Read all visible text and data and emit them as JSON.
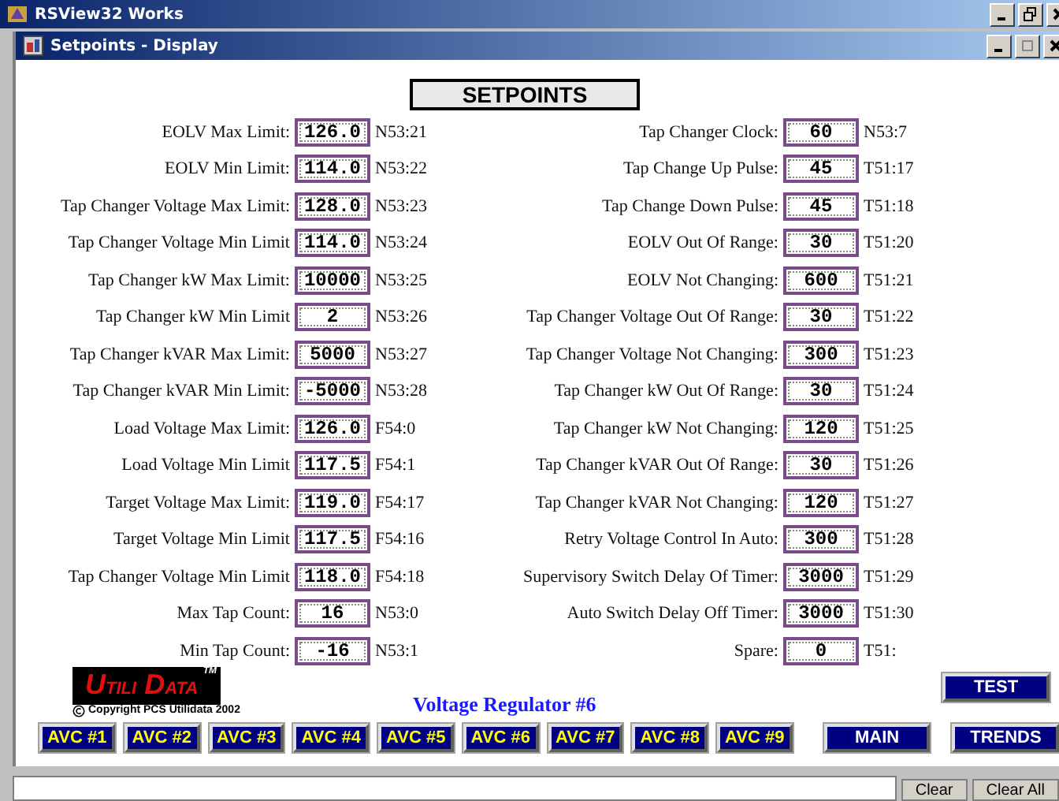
{
  "app_title": "RSView32 Works",
  "window": {
    "title": "Setpoints - Display"
  },
  "heading": "SETPOINTS",
  "left": [
    {
      "label": "EOLV Max Limit:",
      "value": "126.0",
      "address": "N53:21"
    },
    {
      "label": "EOLV Min Limit:",
      "value": "114.0",
      "address": "N53:22"
    },
    {
      "label": "Tap Changer Voltage Max Limit:",
      "value": "128.0",
      "address": "N53:23"
    },
    {
      "label": "Tap Changer Voltage Min Limit",
      "value": "114.0",
      "address": "N53:24"
    },
    {
      "label": "Tap Changer kW Max Limit:",
      "value": "10000",
      "address": "N53:25"
    },
    {
      "label": "Tap Changer kW Min Limit",
      "value": "2",
      "address": "N53:26"
    },
    {
      "label": "Tap Changer kVAR Max Limit:",
      "value": "5000",
      "address": "N53:27"
    },
    {
      "label": "Tap Changer kVAR Min Limit:",
      "value": "-5000",
      "address": "N53:28"
    },
    {
      "label": "Load Voltage Max Limit:",
      "value": "126.0",
      "address": "F54:0"
    },
    {
      "label": "Load Voltage Min Limit",
      "value": "117.5",
      "address": "F54:1"
    },
    {
      "label": "Target Voltage Max Limit:",
      "value": "119.0",
      "address": "F54:17"
    },
    {
      "label": "Target Voltage Min Limit",
      "value": "117.5",
      "address": "F54:16"
    },
    {
      "label": "Tap Changer Voltage Min Limit",
      "value": "118.0",
      "address": "F54:18"
    },
    {
      "label": "Max Tap Count:",
      "value": "16",
      "address": "N53:0"
    },
    {
      "label": "Min Tap Count:",
      "value": "-16",
      "address": "N53:1"
    }
  ],
  "right": [
    {
      "label": "Tap Changer Clock:",
      "value": "60",
      "address": "N53:7"
    },
    {
      "label": "Tap Change Up Pulse:",
      "value": "45",
      "address": "T51:17"
    },
    {
      "label": "Tap Change Down Pulse:",
      "value": "45",
      "address": "T51:18"
    },
    {
      "label": "EOLV Out Of Range:",
      "value": "30",
      "address": "T51:20"
    },
    {
      "label": "EOLV Not Changing:",
      "value": "600",
      "address": "T51:21"
    },
    {
      "label": "Tap Changer Voltage Out Of Range:",
      "value": "30",
      "address": "T51:22"
    },
    {
      "label": "Tap Changer Voltage Not Changing:",
      "value": "300",
      "address": "T51:23"
    },
    {
      "label": "Tap Changer kW Out Of Range:",
      "value": "30",
      "address": "T51:24"
    },
    {
      "label": "Tap Changer kW Not Changing:",
      "value": "120",
      "address": "T51:25"
    },
    {
      "label": "Tap Changer kVAR Out Of Range:",
      "value": "30",
      "address": "T51:26"
    },
    {
      "label": "Tap Changer kVAR Not Changing:",
      "value": "120",
      "address": "T51:27"
    },
    {
      "label": "Retry Voltage Control In Auto:",
      "value": "300",
      "address": "T51:28"
    },
    {
      "label": "Supervisory Switch Delay Of Timer:",
      "value": "3000",
      "address": "T51:29"
    },
    {
      "label": "Auto Switch Delay Off Timer:",
      "value": "3000",
      "address": "T51:30"
    },
    {
      "label": "Spare:",
      "value": "0",
      "address": "T51:"
    }
  ],
  "logo": {
    "words": [
      "UTILI",
      "DATA"
    ],
    "mark": "TM"
  },
  "copyright": "Copyright PCS Utilidata 2002",
  "subtitle": "Voltage Regulator #6",
  "test_button": "TEST",
  "nav_buttons": [
    {
      "label": "AVC #1",
      "kind": "avc"
    },
    {
      "label": "AVC #2",
      "kind": "avc"
    },
    {
      "label": "AVC #3",
      "kind": "avc"
    },
    {
      "label": "AVC #4",
      "kind": "avc"
    },
    {
      "label": "AVC #5",
      "kind": "avc"
    },
    {
      "label": "AVC #6",
      "kind": "avc"
    },
    {
      "label": "AVC #7",
      "kind": "avc"
    },
    {
      "label": "AVC #8",
      "kind": "avc"
    },
    {
      "label": "AVC #9",
      "kind": "avc"
    },
    {
      "label": "MAIN",
      "kind": "nav"
    },
    {
      "label": "TRENDS",
      "kind": "nav"
    }
  ],
  "message_bar": {
    "buttons": [
      "Clear",
      "Clear All"
    ]
  }
}
